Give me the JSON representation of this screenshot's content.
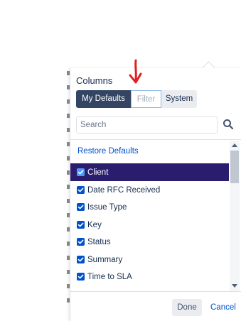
{
  "dialog": {
    "title": "Columns"
  },
  "tabs": [
    {
      "label": "My Defaults",
      "active": true
    },
    {
      "label": "Filter",
      "active": false
    },
    {
      "label": "System",
      "active": false
    }
  ],
  "search": {
    "placeholder": "Search",
    "value": "",
    "icon": "search-icon"
  },
  "restore_label": "Restore Defaults",
  "columns": [
    {
      "label": "Client",
      "checked": true,
      "highlighted": true
    },
    {
      "label": "Date RFC Received",
      "checked": true,
      "highlighted": false
    },
    {
      "label": "Issue Type",
      "checked": true,
      "highlighted": false
    },
    {
      "label": "Key",
      "checked": true,
      "highlighted": false
    },
    {
      "label": "Status",
      "checked": true,
      "highlighted": false
    },
    {
      "label": "Summary",
      "checked": true,
      "highlighted": false
    },
    {
      "label": "Time to SLA",
      "checked": true,
      "highlighted": false
    }
  ],
  "footer": {
    "done_label": "Done",
    "cancel_label": "Cancel"
  },
  "colors": {
    "active_tab": "#344563",
    "highlight_row": "#2b1d6e",
    "checkbox": "#0052cc",
    "link": "#0052cc",
    "annotation_arrow": "#e02020"
  }
}
